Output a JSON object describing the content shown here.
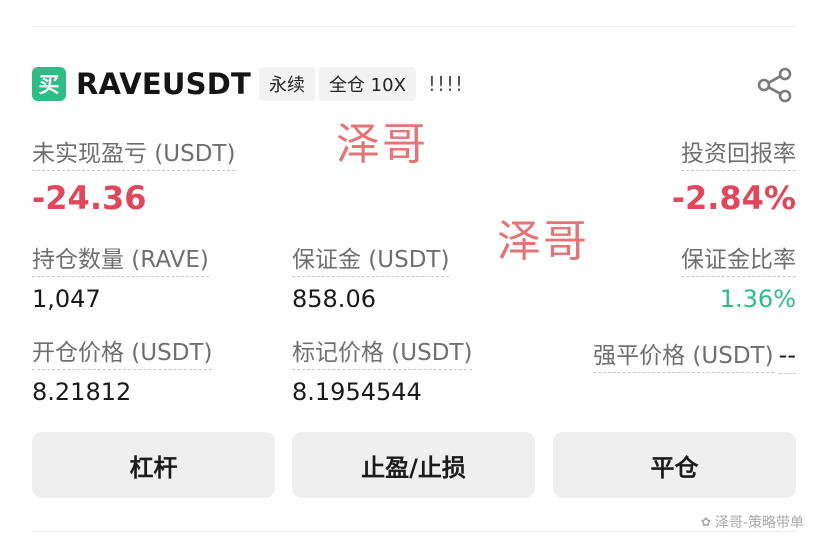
{
  "header": {
    "side_badge": "买",
    "symbol": "RAVEUSDT",
    "tags": [
      "永续",
      "全仓 10X"
    ],
    "marks": "!!!!"
  },
  "watermarks": [
    "泽哥",
    "泽哥"
  ],
  "position": {
    "unrealized_pnl": {
      "label": "未实现盈亏 (USDT)",
      "value": "-24.36"
    },
    "roe": {
      "label": "投资回报率",
      "value": "-2.84%"
    },
    "size": {
      "label": "持仓数量 (RAVE)",
      "value": "1,047"
    },
    "margin": {
      "label": "保证金 (USDT)",
      "value": "858.06"
    },
    "margin_ratio": {
      "label": "保证金比率",
      "value": "1.36%"
    },
    "entry_price": {
      "label": "开仓价格 (USDT)",
      "value": "8.21812"
    },
    "mark_price": {
      "label": "标记价格 (USDT)",
      "value": "8.1954544"
    },
    "liq_price": {
      "label": "强平价格 (USDT)",
      "value": "--"
    }
  },
  "buttons": {
    "leverage": "杠杆",
    "tp_sl": "止盈/止损",
    "close": "平仓"
  },
  "footer_watermark": "泽哥-策略带单",
  "icons": {
    "share": "share-icon",
    "watermark": "wechat-icon"
  },
  "colors": {
    "buy_badge": "#2ebd85",
    "loss": "#e0475a",
    "ratio_good": "#2ebd85",
    "watermark": "#e06a6a"
  }
}
